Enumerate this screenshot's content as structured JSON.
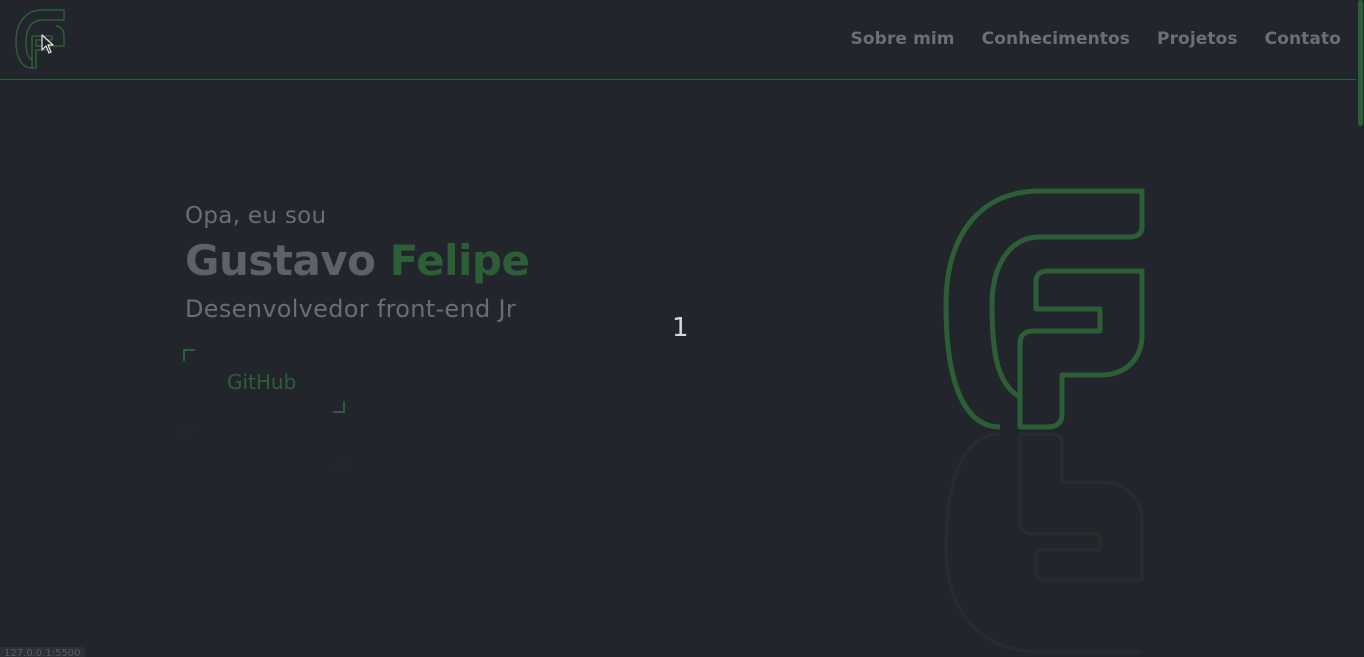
{
  "header": {
    "logo_icon": "gf-logo-icon",
    "nav": [
      {
        "label": "Sobre mim"
      },
      {
        "label": "Conhecimentos"
      },
      {
        "label": "Projetos"
      },
      {
        "label": "Contato"
      }
    ]
  },
  "hero": {
    "intro": "Opa, eu sou",
    "first_name": "Gustavo",
    "last_name": "Felipe",
    "role": "Desenvolvedor front-end Jr",
    "github_label": "GitHub",
    "counter": "1"
  },
  "status_bar": {
    "url": "127.0.0.1:5500"
  },
  "colors": {
    "background": "#23252c",
    "accent": "#2c5f36",
    "nav_text": "#6c6f75",
    "muted_text": "#6a6d72"
  }
}
